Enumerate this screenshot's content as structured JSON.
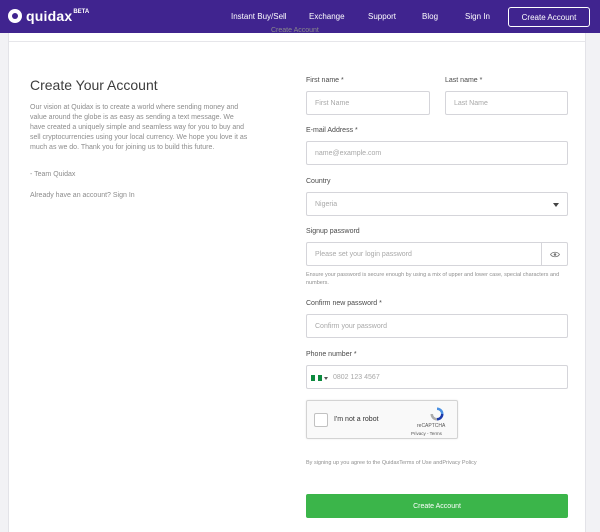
{
  "navbar": {
    "brand": "quidax",
    "beta": "BETA",
    "links": [
      "Instant Buy/Sell",
      "Exchange",
      "Support",
      "Blog",
      "Sign In"
    ],
    "cta": "Create Account"
  },
  "page": {
    "top_text": "Create Account",
    "title": "Create Your Account",
    "body": "Our vision at Quidax is to create a world where sending money and value around the globe is as easy as sending a text message. We have created a uniquely simple and seamless way for you to buy and sell cryptocurrencies using your local currency. We hope you love it as much as we do. Thank you for joining us to build this future.",
    "signature": "- Team Quidax",
    "already": "Already have an account? Sign In"
  },
  "form": {
    "first_name": {
      "label": "First name *",
      "placeholder": "First Name"
    },
    "last_name": {
      "label": "Last name *",
      "placeholder": "Last Name"
    },
    "email": {
      "label": "E-mail Address *",
      "placeholder": "name@example.com"
    },
    "country": {
      "label": "Country",
      "value": "Nigeria"
    },
    "password": {
      "label": "Signup password",
      "placeholder": "Please set your login password",
      "hint": "Ensure your password is secure enough by using a mix of upper and lower case, special characters and numbers."
    },
    "confirm": {
      "label": "Confirm new password *",
      "placeholder": "Confirm your password"
    },
    "phone": {
      "label": "Phone number *",
      "placeholder": "0802 123 4567"
    },
    "captcha": {
      "label": "I'm not a robot",
      "brand": "reCAPTCHA",
      "terms": "Privacy - Terms"
    },
    "terms": "By signing up you agree to the QuidaxTerms of Use andPrivacy Policy",
    "submit": "Create Account"
  },
  "colors": {
    "brand": "#40248f",
    "submit": "#3bb54a"
  }
}
